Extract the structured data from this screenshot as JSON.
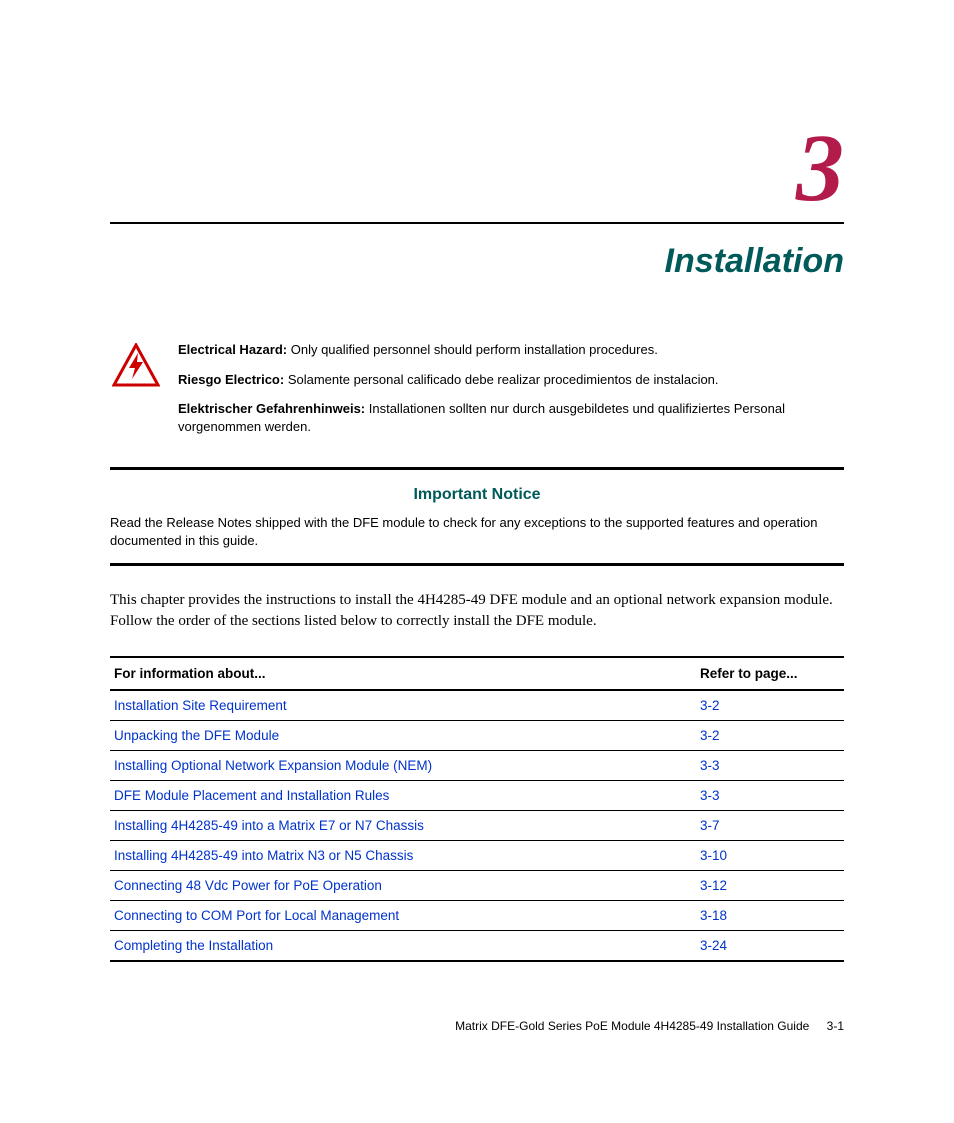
{
  "chapter": {
    "number": "3",
    "title": "Installation"
  },
  "hazard": {
    "en": {
      "label": "Electrical Hazard:",
      "text": "Only qualified personnel should perform installation procedures."
    },
    "es": {
      "label": "Riesgo Electrico:",
      "text": "Solamente personal calificado debe realizar procedimientos de instalacion."
    },
    "de": {
      "label": "Elektrischer Gefahrenhinweis:",
      "text": "Installationen sollten nur durch ausgebildetes und qualifiziertes Personal vorgenommen werden."
    }
  },
  "notice": {
    "heading": "Important Notice",
    "body": "Read the Release Notes shipped with the DFE module to check for any exceptions to the supported features and operation documented in this guide."
  },
  "intro": "This chapter provides the instructions to install the 4H4285-49 DFE module and an optional network expansion module. Follow the order of the sections listed below to correctly install the DFE module.",
  "toc": {
    "col1": "For information about...",
    "col2": "Refer to page...",
    "rows": [
      {
        "title": "Installation Site Requirement",
        "page": "3-2"
      },
      {
        "title": "Unpacking the DFE Module",
        "page": "3-2"
      },
      {
        "title": "Installing Optional Network Expansion Module (NEM)",
        "page": "3-3"
      },
      {
        "title": "DFE Module Placement and Installation Rules",
        "page": "3-3"
      },
      {
        "title": "Installing 4H4285-49 into a Matrix E7 or N7 Chassis",
        "page": "3-7"
      },
      {
        "title": "Installing 4H4285-49 into Matrix N3 or N5 Chassis",
        "page": "3-10"
      },
      {
        "title": "Connecting 48 Vdc Power for PoE Operation",
        "page": "3-12"
      },
      {
        "title": "Connecting to COM Port for Local Management",
        "page": "3-18"
      },
      {
        "title": "Completing the Installation",
        "page": "3-24"
      }
    ]
  },
  "footer": {
    "title": "Matrix DFE-Gold Series PoE Module 4H4285-49 Installation Guide",
    "page": "3-1"
  }
}
